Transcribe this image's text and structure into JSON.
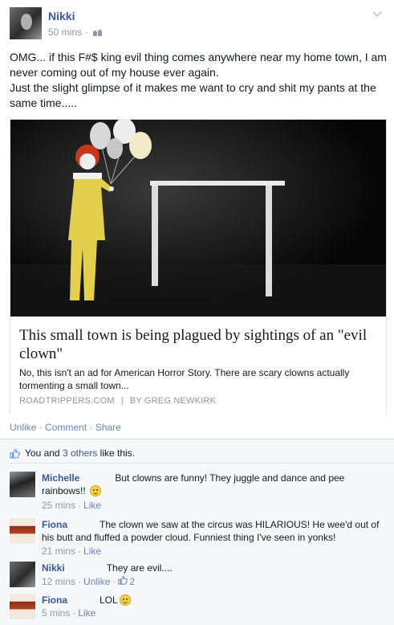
{
  "post": {
    "author": "Nikki",
    "timestamp": "50 mins",
    "separator": "·",
    "audience_icon": "friends-icon",
    "text_lines": [
      "OMG... if this F#$ king evil thing comes anywhere near my home town, I am never coming out of my house ever again.",
      "Just the slight glimpse of it makes me want to cry and shit my pants at the same time....."
    ],
    "link": {
      "title": "This small town is being plagued by sightings of an \"evil clown\"",
      "description": "No, this isn't an ad for American Horror Story. There are scary clowns actually tormenting a small town...",
      "source": "ROADTRIPPERS.COM",
      "source_sep": "|",
      "byline": "BY GREG NEWKIRK"
    },
    "actions": {
      "unlike": "Unlike",
      "dot": "·",
      "comment": "Comment",
      "share": "Share"
    }
  },
  "likes": {
    "prefix": "You and ",
    "others": "3 others",
    "suffix": " like this."
  },
  "comments": [
    {
      "name": "Michelle",
      "text": "But clowns are funny! They juggle and dance and pee rainbows!!",
      "emoji": "smiley",
      "time": "25 mins",
      "action": "Like"
    },
    {
      "name": "Fiona",
      "text": "The clown we saw at the circus was HILARIOUS! He wee'd out of his butt and fluffed a powder cloud. Funniest thing I've seen in yonks!",
      "time": "21 mins",
      "action": "Like"
    },
    {
      "name": "Nikki",
      "text": "They are evil....",
      "time": "12 mins",
      "action": "Unlike",
      "like_count": "2"
    },
    {
      "name": "Fiona",
      "text": "LOL",
      "emoji": "smiley",
      "time": "5 mins",
      "action": "Like"
    }
  ],
  "colors": {
    "link_blue": "#3b5998",
    "meta_gray": "#9197a3",
    "ufi_bg": "#f6f7f9"
  }
}
